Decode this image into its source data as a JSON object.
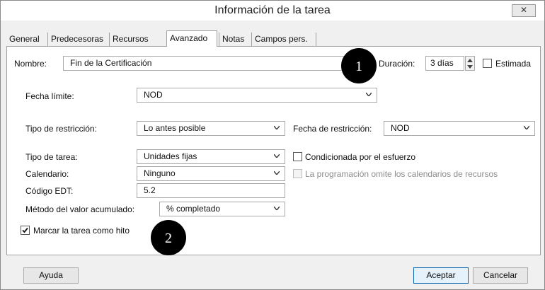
{
  "window": {
    "title": "Información de la tarea",
    "close_symbol": "✕"
  },
  "tabs": [
    {
      "label": "General"
    },
    {
      "label": "Predecesoras"
    },
    {
      "label": "Recursos"
    },
    {
      "label": "Avanzado",
      "active": true
    },
    {
      "label": "Notas"
    },
    {
      "label": "Campos pers."
    }
  ],
  "task": {
    "name_label": "Nombre:",
    "name_value": "Fin de la Certificación",
    "duration_label": "Duración:",
    "duration_value": "3 días",
    "estimated_label": "Estimada",
    "estimated_checked": false
  },
  "advanced": {
    "deadline_label": "Fecha límite:",
    "deadline_value": "NOD",
    "constraint_type_label": "Tipo de restricción:",
    "constraint_type_value": "Lo antes posible",
    "constraint_date_label": "Fecha de restricción:",
    "constraint_date_value": "NOD",
    "task_type_label": "Tipo de tarea:",
    "task_type_value": "Unidades fijas",
    "effort_driven_label": "Condicionada por el esfuerzo",
    "effort_driven_checked": false,
    "calendar_label": "Calendario:",
    "calendar_value": "Ninguno",
    "ignore_resource_calendars_label": "La programación omite los calendarios de recursos",
    "wbs_label": "Código EDT:",
    "wbs_value": "5.2",
    "earned_value_label": "Método del valor acumulado:",
    "earned_value_value": "% completado",
    "milestone_label": "Marcar la tarea como hito",
    "milestone_checked": true
  },
  "markers": [
    {
      "number": "1"
    },
    {
      "number": "2"
    }
  ],
  "buttons": {
    "help": "Ayuda",
    "ok": "Aceptar",
    "cancel": "Cancelar"
  }
}
